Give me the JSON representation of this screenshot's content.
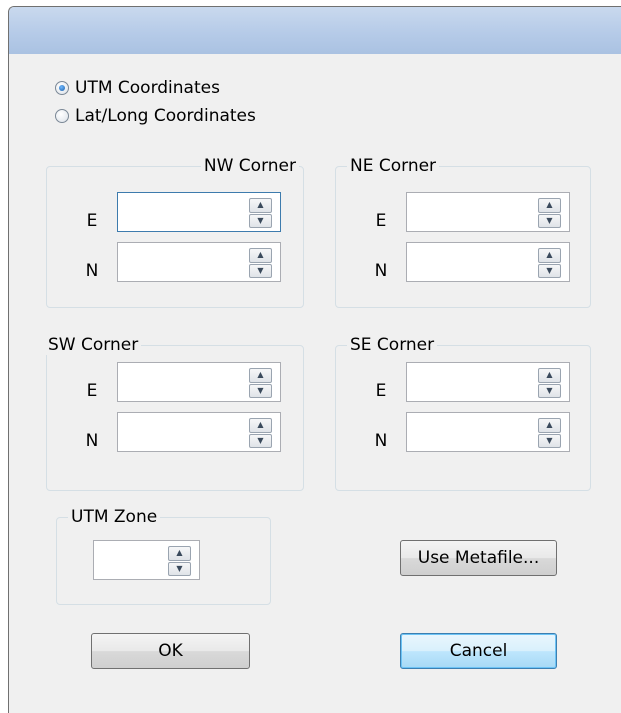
{
  "coordinate_mode": {
    "options": [
      {
        "label": "UTM Coordinates",
        "selected": true
      },
      {
        "label": "Lat/Long Coordinates",
        "selected": false
      }
    ]
  },
  "corners": {
    "nw": {
      "title": "NW Corner",
      "e_label": "E",
      "n_label": "N",
      "e_value": "",
      "n_value": ""
    },
    "ne": {
      "title": "NE Corner",
      "e_label": "E",
      "n_label": "N",
      "e_value": "",
      "n_value": ""
    },
    "sw": {
      "title": "SW Corner",
      "e_label": "E",
      "n_label": "N",
      "e_value": "",
      "n_value": ""
    },
    "se": {
      "title": "SE Corner",
      "e_label": "E",
      "n_label": "N",
      "e_value": "",
      "n_value": ""
    }
  },
  "utm_zone": {
    "title": "UTM Zone",
    "value": ""
  },
  "buttons": {
    "use_metafile": "Use Metafile...",
    "ok": "OK",
    "cancel": "Cancel"
  },
  "icons": {
    "spin_up": "▲",
    "spin_down": "▼"
  },
  "colors": {
    "title_bar": "#b6cbe8",
    "dialog_bg": "#f0f0f0",
    "focus_border": "#3d7bad",
    "default_button": "#bee6fd"
  }
}
